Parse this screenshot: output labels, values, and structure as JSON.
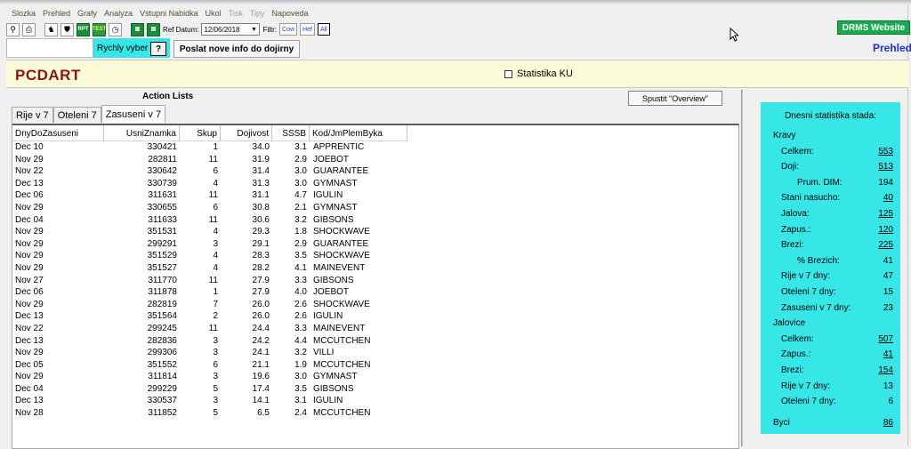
{
  "menu": [
    {
      "label": "Slozka",
      "disabled": false
    },
    {
      "label": "Prehled",
      "disabled": false
    },
    {
      "label": "Grafy",
      "disabled": false
    },
    {
      "label": "Analyza",
      "disabled": false
    },
    {
      "label": "Vstupni Nabidka",
      "disabled": false
    },
    {
      "label": "Ukol",
      "disabled": false
    },
    {
      "label": "Tisk",
      "disabled": true
    },
    {
      "label": "Tipy",
      "disabled": true
    },
    {
      "label": "Napoveda",
      "disabled": false
    }
  ],
  "toolbar": {
    "ref_label": "Ref Datum:",
    "ref_date": "12/06/2018",
    "filter_label": "Filtr:",
    "filters": [
      "Cow",
      "Hef",
      "All"
    ],
    "filter_active": "All",
    "green_btn1": "RPT",
    "green_btn2": "TEST"
  },
  "drms_button": "DRMS Website",
  "prehled_label": "Prehled",
  "quick": {
    "label": "Rychly vyber",
    "help": "?",
    "send_button": "Poslat nove info do dojirny"
  },
  "header": {
    "title": "PCDART",
    "checkbox_label": "Statistika KU"
  },
  "action": {
    "title": "Action Lists",
    "overview_button": "Spustit  \"Overview\"",
    "tabs": [
      "Rije v 7",
      "Oteleni 7",
      "Zasuseni v 7"
    ],
    "active_tab": "Zasuseni v 7",
    "columns": [
      "DnyDoZasuseni",
      "UsniZnamka",
      "Skup",
      "Dojivost",
      "SSSB",
      "Kod/JmPlemByka"
    ],
    "rows": [
      [
        "Dec 10",
        "330421",
        "1",
        "34.0",
        "3.1",
        "APPRENTIC"
      ],
      [
        "Nov 29",
        "282811",
        "11",
        "31.9",
        "2.9",
        "JOEBOT"
      ],
      [
        "Nov 22",
        "330642",
        "6",
        "31.4",
        "3.0",
        "GUARANTEE"
      ],
      [
        "Dec 13",
        "330739",
        "4",
        "31.3",
        "3.0",
        "GYMNAST"
      ],
      [
        "Dec 06",
        "311631",
        "11",
        "31.1",
        "4.7",
        "IGULIN"
      ],
      [
        "Nov 29",
        "330655",
        "6",
        "30.8",
        "2.1",
        "GYMNAST"
      ],
      [
        "Dec 04",
        "311633",
        "11",
        "30.6",
        "3.2",
        "GIBSONS"
      ],
      [
        "Nov 29",
        "351531",
        "4",
        "29.3",
        "1.8",
        "SHOCKWAVE"
      ],
      [
        "Nov 29",
        "299291",
        "3",
        "29.1",
        "2.9",
        "GUARANTEE"
      ],
      [
        "Nov 29",
        "351529",
        "4",
        "28.3",
        "3.5",
        "SHOCKWAVE"
      ],
      [
        "Nov 29",
        "351527",
        "4",
        "28.2",
        "4.1",
        "MAINEVENT"
      ],
      [
        "Nov 27",
        "311770",
        "11",
        "27.9",
        "3.3",
        "GIBSONS"
      ],
      [
        "Dec 06",
        "311878",
        "1",
        "27.9",
        "4.0",
        "JOEBOT"
      ],
      [
        "Nov 29",
        "282819",
        "7",
        "26.0",
        "2.6",
        "SHOCKWAVE"
      ],
      [
        "Dec 13",
        "351564",
        "2",
        "26.0",
        "2.6",
        "IGULIN"
      ],
      [
        "Nov 22",
        "299245",
        "11",
        "24.4",
        "3.3",
        "MAINEVENT"
      ],
      [
        "Dec 13",
        "282836",
        "3",
        "24.2",
        "4.4",
        "MCCUTCHEN"
      ],
      [
        "Nov 29",
        "299306",
        "3",
        "24.1",
        "3.2",
        "VILLI"
      ],
      [
        "Dec 05",
        "351552",
        "6",
        "21.1",
        "1.9",
        "MCCUTCHEN"
      ],
      [
        "Nov 29",
        "311814",
        "3",
        "19.6",
        "3.0",
        "GYMNAST"
      ],
      [
        "Dec 04",
        "299229",
        "5",
        "17.4",
        "3.5",
        "GIBSONS"
      ],
      [
        "Dec 13",
        "330537",
        "3",
        "14.1",
        "3.1",
        "IGULIN"
      ],
      [
        "Nov 28",
        "311852",
        "5",
        "6.5",
        "2.4",
        "MCCUTCHEN"
      ]
    ]
  },
  "stats": {
    "title": "Dnesni statistika stada:",
    "items": [
      {
        "label": "Kravy",
        "value": "",
        "link": false,
        "indent": 0,
        "gap": 0
      },
      {
        "label": "Celkem:",
        "value": "553",
        "link": true,
        "indent": 1,
        "gap": 0
      },
      {
        "label": "Doji:",
        "value": "513",
        "link": true,
        "indent": 1,
        "gap": 0
      },
      {
        "label": "Prum. DIM:",
        "value": "194",
        "link": false,
        "indent": 2,
        "gap": 0
      },
      {
        "label": "Stani nasucho:",
        "value": "40",
        "link": true,
        "indent": 1,
        "gap": 0
      },
      {
        "label": "Jalova:",
        "value": "125",
        "link": true,
        "indent": 1,
        "gap": 0
      },
      {
        "label": "Zapus.:",
        "value": "120",
        "link": true,
        "indent": 1,
        "gap": 0
      },
      {
        "label": "Brezi:",
        "value": "225",
        "link": true,
        "indent": 1,
        "gap": 0
      },
      {
        "label": "% Brezich:",
        "value": "41",
        "link": false,
        "indent": 2,
        "gap": 0
      },
      {
        "label": "Rije v 7 dny:",
        "value": "47",
        "link": false,
        "indent": 1,
        "gap": 0
      },
      {
        "label": "Oteleni 7 dny:",
        "value": "15",
        "link": false,
        "indent": 1,
        "gap": 0
      },
      {
        "label": "Zasuseni v 7 dny:",
        "value": "23",
        "link": false,
        "indent": 1,
        "gap": 0
      },
      {
        "label": "Jalovice",
        "value": "",
        "link": false,
        "indent": 0,
        "gap": 0
      },
      {
        "label": "Celkem:",
        "value": "507",
        "link": true,
        "indent": 1,
        "gap": 0
      },
      {
        "label": "Zapus.:",
        "value": "41",
        "link": true,
        "indent": 1,
        "gap": 0
      },
      {
        "label": "Brezi:",
        "value": "154",
        "link": true,
        "indent": 1,
        "gap": 0
      },
      {
        "label": "Rije v 7 dny:",
        "value": "13",
        "link": false,
        "indent": 1,
        "gap": 0
      },
      {
        "label": "Oteleni 7 dny:",
        "value": "6",
        "link": false,
        "indent": 1,
        "gap": 0
      },
      {
        "label": "Byci",
        "value": "86",
        "link": true,
        "indent": 0,
        "gap": 1
      }
    ]
  }
}
